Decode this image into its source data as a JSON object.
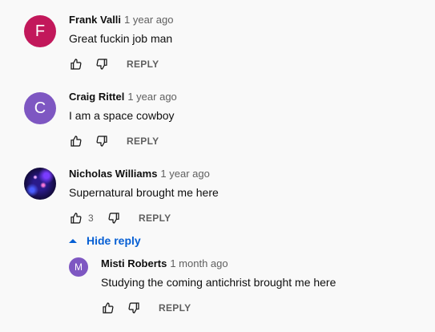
{
  "comments": [
    {
      "author": "Frank Valli",
      "time": "1 year ago",
      "text": "Great fuckin job man",
      "avatar_letter": "F",
      "avatar_color": "#c2185b",
      "like_count": "",
      "reply_label": "REPLY"
    },
    {
      "author": "Craig Rittel",
      "time": "1 year ago",
      "text": "I am a space cowboy",
      "avatar_letter": "C",
      "avatar_color": "#7e57c2",
      "like_count": "",
      "reply_label": "REPLY"
    },
    {
      "author": "Nicholas Williams",
      "time": "1 year ago",
      "text": "Supernatural brought me here",
      "avatar_letter": "",
      "avatar_color": "#2a1a8a",
      "like_count": "3",
      "reply_label": "REPLY"
    }
  ],
  "hide_reply_label": "Hide reply",
  "reply": {
    "author": "Misti Roberts",
    "time": "1 month ago",
    "text": "Studying the coming antichrist brought me here",
    "avatar_letter": "M",
    "avatar_color": "#7e57c2",
    "reply_label": "REPLY"
  }
}
